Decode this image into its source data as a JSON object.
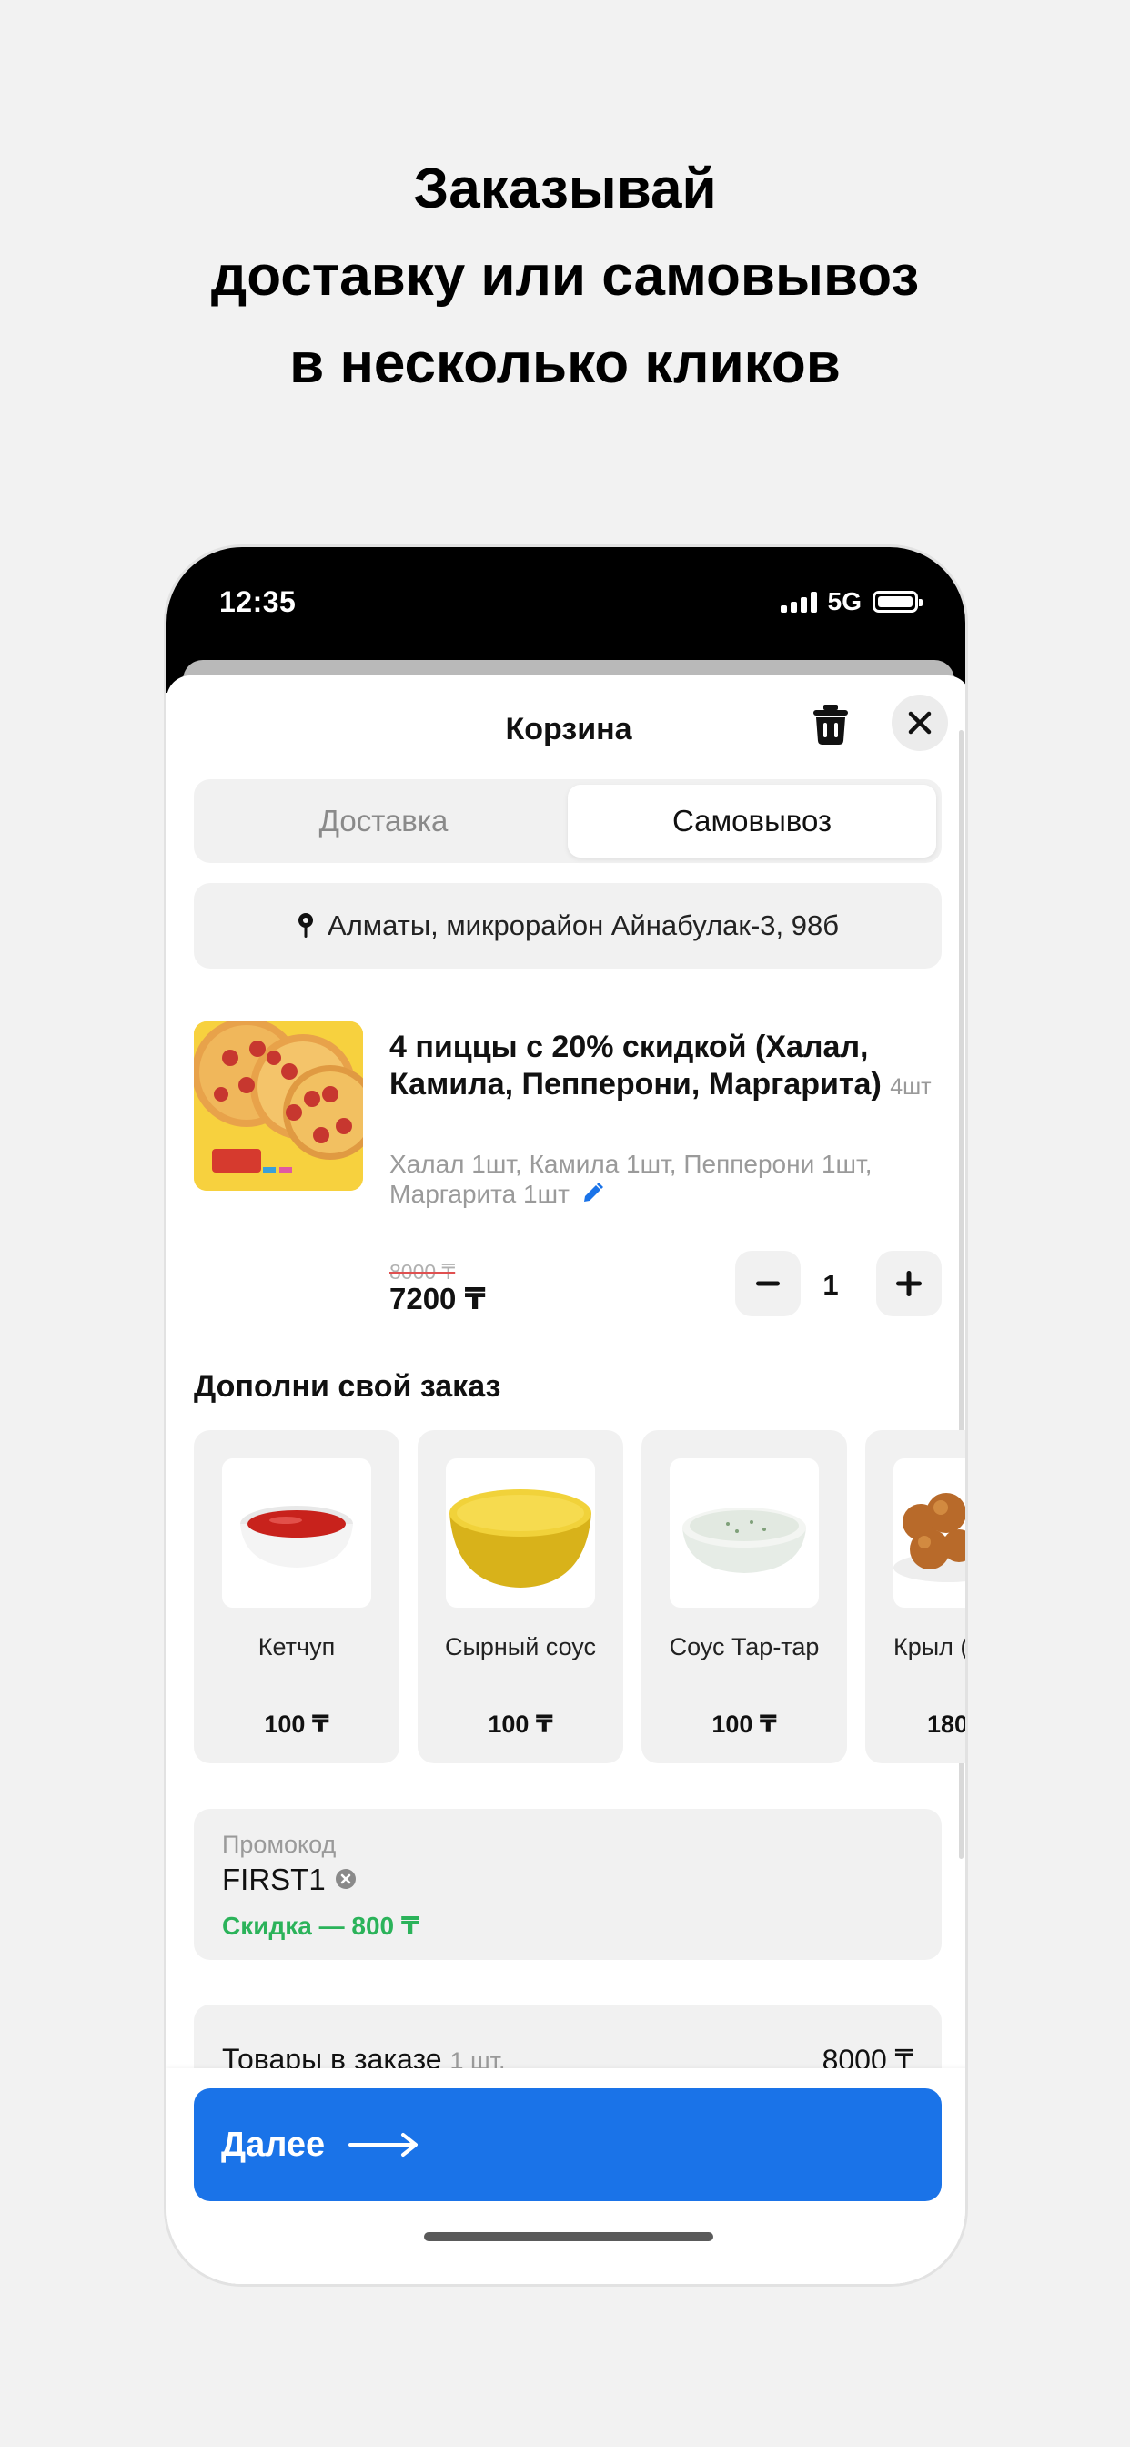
{
  "headline": {
    "line1": "Заказывай",
    "line2": "доставку или самовывоз",
    "line3": "в несколько кликов"
  },
  "status_bar": {
    "time": "12:35",
    "network": "5G"
  },
  "cart": {
    "title": "Корзина",
    "trash_icon": "trash-icon",
    "close_icon": "close-icon"
  },
  "tabs": [
    {
      "label": "Доставка",
      "active": false
    },
    {
      "label": "Самовывоз",
      "active": true
    }
  ],
  "address": {
    "icon": "location-pin-icon",
    "text": "Алматы, микрорайон Айнабулак-3, 98б"
  },
  "product": {
    "name": "4 пиццы с 20% скидкой (Халал, Камила, Пепперони, Маргарита)",
    "count_label": "4шт",
    "description": "Халал 1шт, Камила 1шт, Пепперони 1шт, Маргарита 1шт",
    "old_price": "8000 ₸",
    "price": "7200 ₸",
    "quantity": "1"
  },
  "addons_section": {
    "title": "Дополни свой заказ",
    "items": [
      {
        "name": "Кетчуп",
        "price": "100 ₸"
      },
      {
        "name": "Сырный соус",
        "price": "100 ₸"
      },
      {
        "name": "Соус Тар-тар",
        "price": "100 ₸"
      },
      {
        "name": "Крыл (остре",
        "price": "180"
      }
    ]
  },
  "promo": {
    "label": "Промокод",
    "code": "FIRST1",
    "discount": "Скидка — 800 ₸"
  },
  "summary": {
    "label": "Товары в заказе",
    "count": "1 шт.",
    "value": "8000 ₸"
  },
  "next_button": {
    "label": "Далее"
  },
  "colors": {
    "accent": "#1a73e8",
    "discount_green": "#2bb35a",
    "muted": "#9a9a9a"
  }
}
